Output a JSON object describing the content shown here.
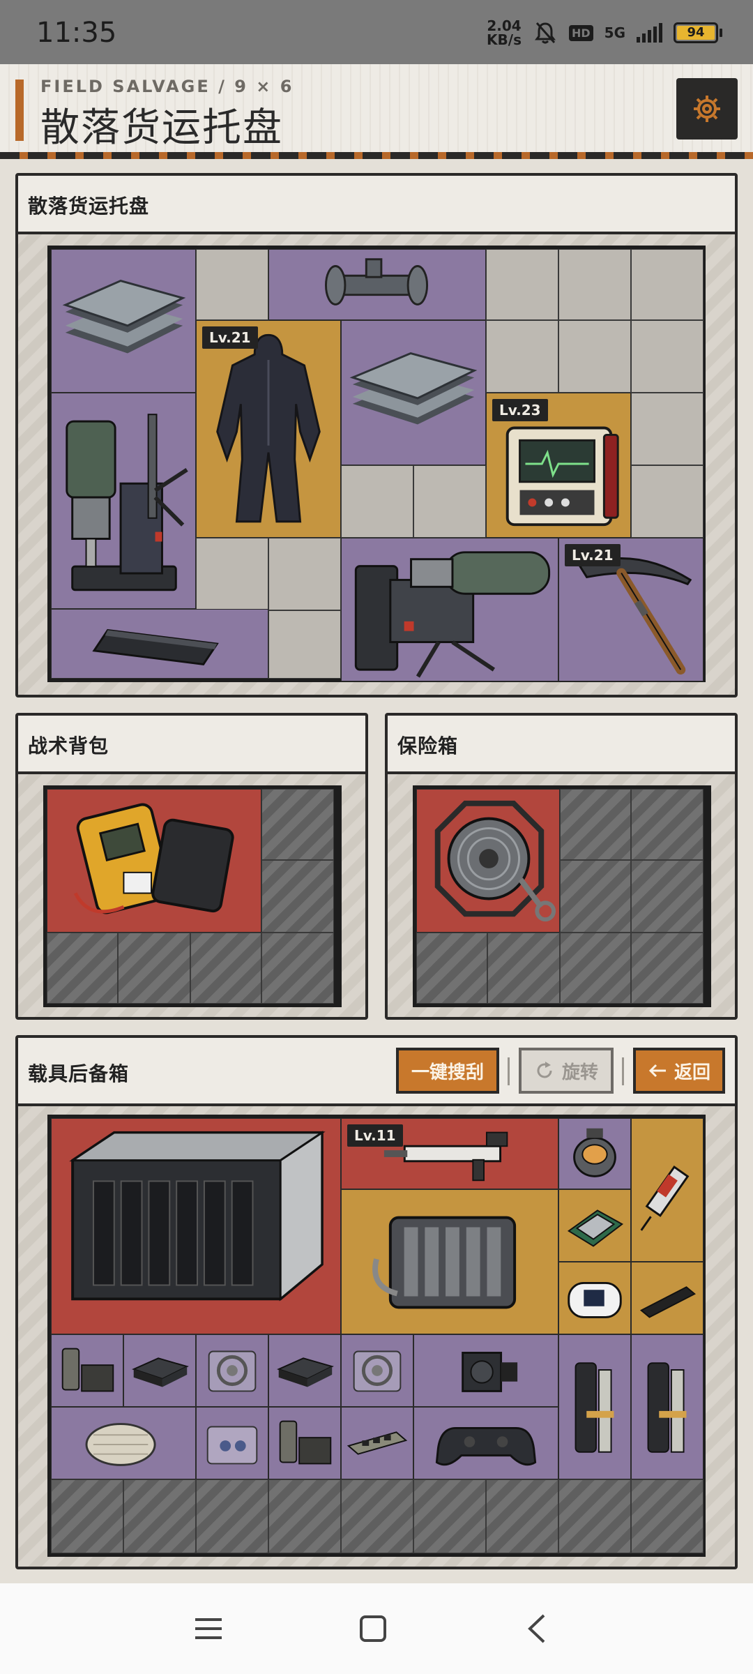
{
  "status_bar": {
    "time": "11:35",
    "speed_value": "2.04",
    "speed_unit": "KB/s",
    "hd": "HD",
    "network": "5G",
    "battery": "94"
  },
  "header": {
    "subtitle": "FIELD SALVAGE / 9 × 6",
    "title": "散落货运托盘",
    "settings_icon": "gear-icon"
  },
  "colors": {
    "accent": "#b8692a",
    "rarity_purple": "#8b79a1",
    "rarity_gold": "#c59540",
    "rarity_red": "#b2463d"
  },
  "pallet": {
    "title": "散落货运托盘",
    "items": [
      {
        "name": "metal-plates",
        "rarity": "purple"
      },
      {
        "name": "pipe-fitting",
        "rarity": "purple"
      },
      {
        "name": "tactical-suit",
        "rarity": "gold",
        "level": "Lv.21"
      },
      {
        "name": "metal-plates",
        "rarity": "purple"
      },
      {
        "name": "magnetic-drill",
        "rarity": "purple"
      },
      {
        "name": "vital-monitor",
        "rarity": "gold",
        "level": "Lv.23"
      },
      {
        "name": "drill-rig",
        "rarity": "purple"
      },
      {
        "name": "pickaxe",
        "rarity": "purple",
        "level": "Lv.21"
      },
      {
        "name": "portable-printer",
        "rarity": "purple"
      }
    ]
  },
  "backpack": {
    "title": "战术背包",
    "items": [
      {
        "name": "defibrillator-case",
        "rarity": "red"
      }
    ]
  },
  "safe": {
    "title": "保险箱",
    "items": [
      {
        "name": "cable-reel",
        "rarity": "red"
      }
    ]
  },
  "trunk": {
    "title": "载具后备箱",
    "buttons": {
      "search_all": "一键搜刮",
      "rotate": "旋转",
      "back": "返回"
    },
    "items": [
      {
        "name": "nas-server",
        "rarity": "red"
      },
      {
        "name": "rifle",
        "rarity": "red",
        "level": "Lv.11"
      },
      {
        "name": "reactor-core",
        "rarity": "purple"
      },
      {
        "name": "syringe",
        "rarity": "gold"
      },
      {
        "name": "engine-block",
        "rarity": "gold"
      },
      {
        "name": "cpu-chip",
        "rarity": "gold"
      },
      {
        "name": "pulse-oximeter",
        "rarity": "gold"
      },
      {
        "name": "ssd-stick",
        "rarity": "gold"
      },
      {
        "name": "toolbox",
        "rarity": "purple"
      },
      {
        "name": "mini-pc",
        "rarity": "purple"
      },
      {
        "name": "bearing-box",
        "rarity": "purple"
      },
      {
        "name": "mini-pc",
        "rarity": "purple"
      },
      {
        "name": "bearing-box",
        "rarity": "purple"
      },
      {
        "name": "servo-motor",
        "rarity": "purple"
      },
      {
        "name": "smart-lock",
        "rarity": "purple"
      },
      {
        "name": "smart-lock",
        "rarity": "purple"
      },
      {
        "name": "bandage-roll",
        "rarity": "purple"
      },
      {
        "name": "parts-box",
        "rarity": "purple"
      },
      {
        "name": "toolbox",
        "rarity": "purple"
      },
      {
        "name": "memory-module",
        "rarity": "purple"
      },
      {
        "name": "gamepad",
        "rarity": "purple"
      }
    ]
  },
  "navbar": {
    "menu_icon": "menu-icon",
    "home_icon": "home-icon",
    "back_icon": "back-icon"
  }
}
